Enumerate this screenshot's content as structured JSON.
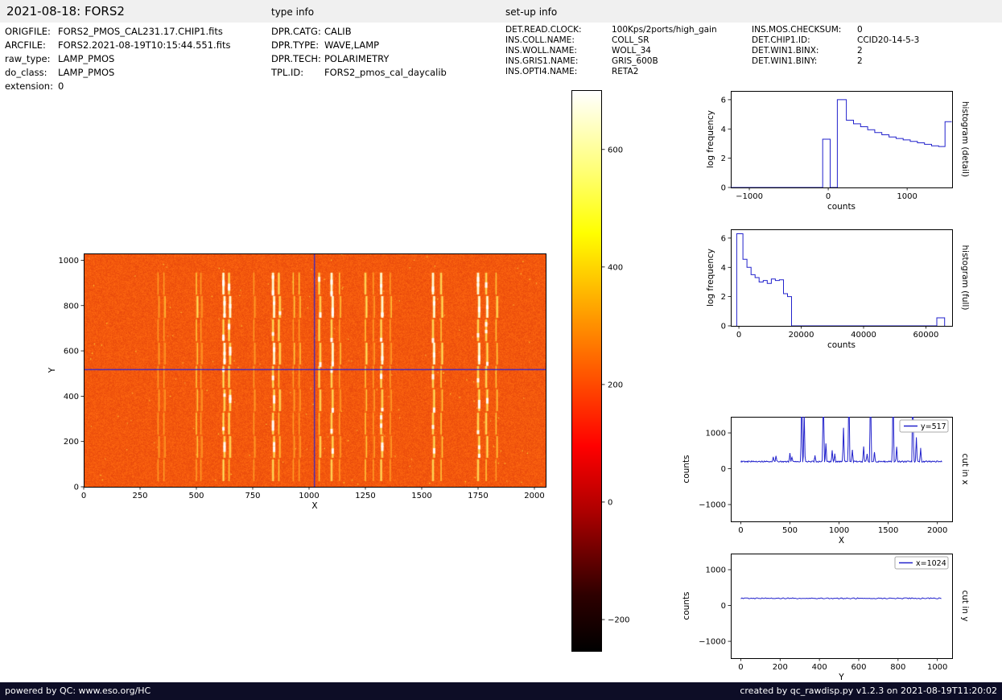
{
  "header": {
    "title": "2021-08-18: FORS2",
    "type_info_label": "type info",
    "setup_info_label": "set-up info"
  },
  "file_info": {
    "rows": [
      {
        "label": "ORIGFILE:",
        "value": "FORS2_PMOS_CAL231.17.CHIP1.fits"
      },
      {
        "label": "ARCFILE:",
        "value": "FORS2.2021-08-19T10:15:44.551.fits"
      },
      {
        "label": "raw_type:",
        "value": "LAMP_PMOS"
      },
      {
        "label": "do_class:",
        "value": "LAMP_PMOS"
      },
      {
        "label": "extension:",
        "value": "0"
      }
    ]
  },
  "type_info": {
    "rows": [
      {
        "label": "DPR.CATG:",
        "value": "CALIB"
      },
      {
        "label": "DPR.TYPE:",
        "value": "WAVE,LAMP"
      },
      {
        "label": "DPR.TECH:",
        "value": "POLARIMETRY"
      },
      {
        "label": "TPL.ID:",
        "value": "FORS2_pmos_cal_daycalib"
      }
    ]
  },
  "setup_info_left": {
    "rows": [
      {
        "label": "DET.READ.CLOCK:",
        "value": "100Kps/2ports/high_gain"
      },
      {
        "label": "INS.COLL.NAME:",
        "value": "COLL_SR"
      },
      {
        "label": "INS.WOLL.NAME:",
        "value": "WOLL_34"
      },
      {
        "label": "INS.GRIS1.NAME:",
        "value": "GRIS_600B"
      },
      {
        "label": "INS.OPTI4.NAME:",
        "value": "RETA2"
      }
    ]
  },
  "setup_info_right": {
    "rows": [
      {
        "label": "INS.MOS.CHECKSUM:",
        "value": "0"
      },
      {
        "label": "DET.CHIP1.ID:",
        "value": "CCID20-14-5-3"
      },
      {
        "label": "DET.WIN1.BINX:",
        "value": "2"
      },
      {
        "label": "DET.WIN1.BINY:",
        "value": "2"
      }
    ]
  },
  "footer": {
    "left": "powered by QC: www.eso.org/HC",
    "right": "created by qc_rawdisp.py v1.2.3 on 2021-08-19T11:20:02"
  },
  "colors": {
    "accent_blue": "#2222cc",
    "image_base": "#f35808",
    "header_bg": "#f0f0f0",
    "footer_bg": "#0d0d26"
  },
  "chart_data": [
    {
      "name": "detector_image",
      "type": "heatmap",
      "xlabel": "X",
      "ylabel": "Y",
      "xlim": [
        0,
        2050
      ],
      "ylim": [
        0,
        1030
      ],
      "xticks": [
        0,
        250,
        500,
        750,
        1000,
        1250,
        1500,
        1750,
        2000
      ],
      "yticks": [
        0,
        200,
        400,
        600,
        800,
        1000
      ],
      "background_level_counts": 200,
      "crosshair": {
        "x": 1024,
        "y": 517
      },
      "lines_y_range": [
        25,
        950
      ],
      "strip_height": 103,
      "strip_gap": 7,
      "arc_lines": [
        {
          "x": 330,
          "strength": 0.45
        },
        {
          "x": 356,
          "strength": 0.55
        },
        {
          "x": 500,
          "strength": 0.7
        },
        {
          "x": 520,
          "strength": 0.5
        },
        {
          "x": 620,
          "strength": 1.0
        },
        {
          "x": 645,
          "strength": 0.9
        },
        {
          "x": 755,
          "strength": 0.5
        },
        {
          "x": 840,
          "strength": 1.0
        },
        {
          "x": 866,
          "strength": 0.8
        },
        {
          "x": 930,
          "strength": 0.6
        },
        {
          "x": 956,
          "strength": 0.6
        },
        {
          "x": 1045,
          "strength": 0.85
        },
        {
          "x": 1100,
          "strength": 1.0
        },
        {
          "x": 1135,
          "strength": 0.6
        },
        {
          "x": 1250,
          "strength": 0.75
        },
        {
          "x": 1285,
          "strength": 0.5
        },
        {
          "x": 1320,
          "strength": 1.0
        },
        {
          "x": 1360,
          "strength": 0.55
        },
        {
          "x": 1550,
          "strength": 1.0
        },
        {
          "x": 1586,
          "strength": 0.75
        },
        {
          "x": 1750,
          "strength": 1.0
        },
        {
          "x": 1786,
          "strength": 0.9
        },
        {
          "x": 1830,
          "strength": 0.7
        }
      ]
    },
    {
      "name": "colorbar",
      "type": "colorbar",
      "colormap": "hot",
      "vmin": -252,
      "vmax": 701,
      "ticks": [
        600,
        400,
        200,
        0,
        -200
      ],
      "tick_labels": [
        "600",
        "400",
        "200",
        "0",
        "−200"
      ]
    },
    {
      "name": "histogram_detail",
      "type": "step",
      "xlabel": "counts",
      "ylabel": "log frequency",
      "right_label": "histogram (detail)",
      "xlim": [
        -1235,
        1570
      ],
      "ylim": [
        0,
        6.6
      ],
      "xticks": [
        -1000,
        0,
        1000
      ],
      "xtick_labels": [
        "−1000",
        "0",
        "1000"
      ],
      "yticks": [
        0,
        2,
        4,
        6
      ],
      "points": [
        [
          -1235,
          0
        ],
        [
          -70,
          0
        ],
        [
          -70,
          3.3
        ],
        [
          25,
          3.3
        ],
        [
          25,
          0
        ],
        [
          115,
          0
        ],
        [
          115,
          6.0
        ],
        [
          230,
          6.0
        ],
        [
          230,
          4.6
        ],
        [
          320,
          4.6
        ],
        [
          320,
          4.35
        ],
        [
          410,
          4.35
        ],
        [
          410,
          4.15
        ],
        [
          500,
          4.15
        ],
        [
          500,
          3.95
        ],
        [
          590,
          3.95
        ],
        [
          590,
          3.75
        ],
        [
          680,
          3.75
        ],
        [
          680,
          3.6
        ],
        [
          770,
          3.6
        ],
        [
          770,
          3.45
        ],
        [
          860,
          3.45
        ],
        [
          860,
          3.35
        ],
        [
          950,
          3.35
        ],
        [
          950,
          3.25
        ],
        [
          1040,
          3.25
        ],
        [
          1040,
          3.15
        ],
        [
          1130,
          3.15
        ],
        [
          1130,
          3.05
        ],
        [
          1220,
          3.05
        ],
        [
          1220,
          2.95
        ],
        [
          1310,
          2.95
        ],
        [
          1310,
          2.85
        ],
        [
          1400,
          2.85
        ],
        [
          1400,
          2.8
        ],
        [
          1480,
          2.8
        ],
        [
          1480,
          4.5
        ],
        [
          1565,
          4.5
        ]
      ]
    },
    {
      "name": "histogram_full",
      "type": "step",
      "xlabel": "counts",
      "ylabel": "log frequency",
      "right_label": "histogram (full)",
      "xlim": [
        -2600,
        68400
      ],
      "ylim": [
        0,
        6.6
      ],
      "xticks": [
        0,
        20000,
        40000,
        60000
      ],
      "xtick_labels": [
        "0",
        "20000",
        "40000",
        "60000"
      ],
      "yticks": [
        0,
        2,
        4,
        6
      ],
      "points": [
        [
          -700,
          0
        ],
        [
          -700,
          6.3
        ],
        [
          1300,
          6.3
        ],
        [
          1300,
          4.55
        ],
        [
          2600,
          4.55
        ],
        [
          2600,
          4.0
        ],
        [
          3900,
          4.0
        ],
        [
          3900,
          3.5
        ],
        [
          5200,
          3.5
        ],
        [
          5200,
          3.3
        ],
        [
          6500,
          3.3
        ],
        [
          6500,
          3.0
        ],
        [
          7800,
          3.0
        ],
        [
          7800,
          3.1
        ],
        [
          9100,
          3.1
        ],
        [
          9100,
          2.9
        ],
        [
          10400,
          2.9
        ],
        [
          10400,
          3.2
        ],
        [
          11700,
          3.2
        ],
        [
          11700,
          3.1
        ],
        [
          13000,
          3.1
        ],
        [
          13000,
          3.15
        ],
        [
          14300,
          3.15
        ],
        [
          14300,
          2.2
        ],
        [
          15600,
          2.2
        ],
        [
          15600,
          2.0
        ],
        [
          16900,
          2.0
        ],
        [
          16900,
          0
        ],
        [
          63500,
          0
        ],
        [
          63500,
          0.55
        ],
        [
          66000,
          0.55
        ],
        [
          66000,
          0
        ]
      ]
    },
    {
      "name": "cut_in_x",
      "type": "line",
      "xlabel": "X",
      "ylabel": "counts",
      "right_label": "cut in x",
      "legend": "y=517",
      "xlim": [
        -102,
        2150
      ],
      "ylim": [
        -1470,
        1450
      ],
      "data_xmax": 2048,
      "xticks": [
        0,
        500,
        1000,
        1500,
        2000
      ],
      "xtick_labels": [
        "0",
        "500",
        "1000",
        "1500",
        "2000"
      ],
      "yticks": [
        -1000,
        0,
        1000
      ],
      "ytick_labels": [
        "−1000",
        "0",
        "1000"
      ],
      "baseline": 200,
      "noise": 18,
      "spikes": [
        [
          330,
          130
        ],
        [
          358,
          170
        ],
        [
          500,
          240
        ],
        [
          520,
          130
        ],
        [
          620,
          2200
        ],
        [
          645,
          1400
        ],
        [
          755,
          160
        ],
        [
          840,
          2200
        ],
        [
          866,
          520
        ],
        [
          930,
          300
        ],
        [
          956,
          220
        ],
        [
          1045,
          950
        ],
        [
          1100,
          2200
        ],
        [
          1135,
          320
        ],
        [
          1250,
          430
        ],
        [
          1285,
          200
        ],
        [
          1320,
          2200
        ],
        [
          1360,
          260
        ],
        [
          1550,
          2200
        ],
        [
          1586,
          420
        ],
        [
          1750,
          2200
        ],
        [
          1786,
          680
        ],
        [
          1830,
          370
        ]
      ]
    },
    {
      "name": "cut_in_y",
      "type": "line",
      "xlabel": "Y",
      "ylabel": "counts",
      "right_label": "cut in y",
      "legend": "x=1024",
      "xlim": [
        -51,
        1075
      ],
      "ylim": [
        -1470,
        1450
      ],
      "data_xmax": 1024,
      "xticks": [
        0,
        200,
        400,
        600,
        800,
        1000
      ],
      "xtick_labels": [
        "0",
        "200",
        "400",
        "600",
        "800",
        "1000"
      ],
      "yticks": [
        -1000,
        0,
        1000
      ],
      "ytick_labels": [
        "−1000",
        "0",
        "1000"
      ],
      "baseline": 200,
      "noise": 15,
      "spikes": []
    }
  ]
}
